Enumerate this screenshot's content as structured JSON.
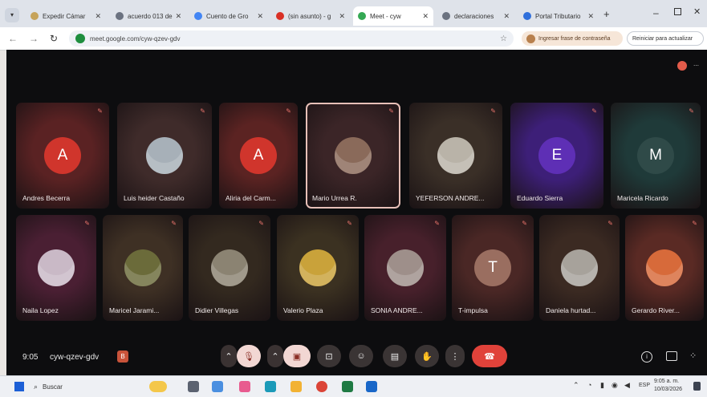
{
  "browser": {
    "tabs": [
      {
        "title": "Expedir Cámar",
        "favicon_color": "#c6a35a"
      },
      {
        "title": "acuerdo 013 de",
        "favicon_color": "#6b7280"
      },
      {
        "title": "Cuento de Gro",
        "favicon_color": "#4285f4"
      },
      {
        "title": "(sin asunto) - g",
        "favicon_color": "#d93025"
      },
      {
        "title": "Meet - cyw",
        "favicon_color": "#34a853"
      },
      {
        "title": "declaraciones",
        "favicon_color": "#6b7280"
      },
      {
        "title": "Portal Tributario",
        "favicon_color": "#2f6fdb"
      }
    ],
    "new_tab": "+",
    "address": "meet.google.com/cyw-qzev-gdv",
    "password_prompt": "Ingresar frase de contraseña",
    "restart_prompt": "Reiniciar para actualizar"
  },
  "meet": {
    "row1": [
      {
        "name": "Andres Becerra",
        "initial": "A",
        "avatar_color": "#d0352c",
        "tile_color": "#5a2223"
      },
      {
        "name": "Luis heider Castaño",
        "initial": "",
        "avatar_color": "#a7b0b8",
        "tile_color": "#3f2b2a"
      },
      {
        "name": "Aliria del Carm...",
        "initial": "A",
        "avatar_color": "#d0352c",
        "tile_color": "#5b2322"
      },
      {
        "name": "Mario Urrea R.",
        "initial": "",
        "avatar_color": "#8a6a5a",
        "tile_color": "#3b2527"
      },
      {
        "name": "YEFERSON ANDRE...",
        "initial": "",
        "avatar_color": "#b9b3a8",
        "tile_color": "#3a2f27"
      },
      {
        "name": "Eduardo Sierra",
        "initial": "E",
        "avatar_color": "#5e2fb5",
        "tile_color": "#3d1f78"
      },
      {
        "name": "Maricela Ricardo",
        "initial": "M",
        "avatar_color": "#2f4a48",
        "tile_color": "#1f3a39"
      }
    ],
    "row2": [
      {
        "name": "Naila Lopez",
        "initial": "",
        "avatar_color": "#c9b9c6",
        "tile_color": "#4a1f33"
      },
      {
        "name": "Maricel Jarami...",
        "initial": "",
        "avatar_color": "#6b6b3a",
        "tile_color": "#3e3024"
      },
      {
        "name": "Didier Villegas",
        "initial": "",
        "avatar_color": "#8b8372",
        "tile_color": "#33291f"
      },
      {
        "name": "Valerio Plaza",
        "initial": "",
        "avatar_color": "#c9a23a",
        "tile_color": "#3b3121"
      },
      {
        "name": "SONIA ANDRE...",
        "initial": "",
        "avatar_color": "#9e8f8a",
        "tile_color": "#47202b"
      },
      {
        "name": "T-impulsa",
        "initial": "T",
        "avatar_color": "#9a6e60",
        "tile_color": "#4a2725"
      },
      {
        "name": "Daniela hurtad...",
        "initial": "",
        "avatar_color": "#a7a29b",
        "tile_color": "#3b2a22"
      },
      {
        "name": "Gerardo River...",
        "initial": "",
        "avatar_color": "#d76a3a",
        "tile_color": "#5a2a24"
      }
    ],
    "time": "9:05",
    "meeting_code": "cyw-qzev-gdv",
    "colors": {
      "end_call": "#e0423a",
      "stage": "#0d0d0f",
      "mic_off": "#e8736b"
    }
  },
  "taskbar": {
    "search_placeholder": "Buscar",
    "language": "ESP",
    "clock_time": "9:05 a. m.",
    "clock_date": "10/03/2026"
  }
}
